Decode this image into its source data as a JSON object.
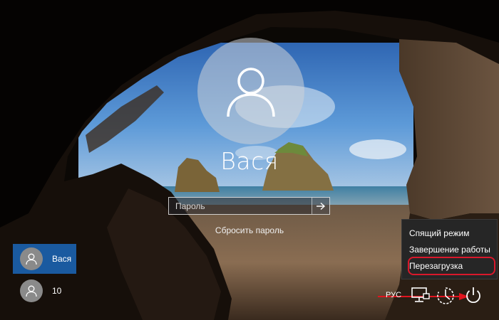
{
  "login": {
    "user_name": "Вася",
    "password_placeholder": "Пароль",
    "reset_password": "Сбросить пароль"
  },
  "user_list": [
    {
      "label": "Вася",
      "active": true
    },
    {
      "label": "10",
      "active": false
    }
  ],
  "power_menu": {
    "items": [
      {
        "label": "Спящий режим"
      },
      {
        "label": "Завершение работы"
      },
      {
        "label": "Перезагрузка"
      }
    ],
    "highlighted_item": "Перезагрузка"
  },
  "bottom_bar": {
    "language": "РУС",
    "icons": [
      "network-icon",
      "ease-of-access-icon",
      "power-icon"
    ]
  },
  "colors": {
    "active_user": "#1a5aa0",
    "menu_background": "#262626",
    "highlight": "#d9182b"
  }
}
